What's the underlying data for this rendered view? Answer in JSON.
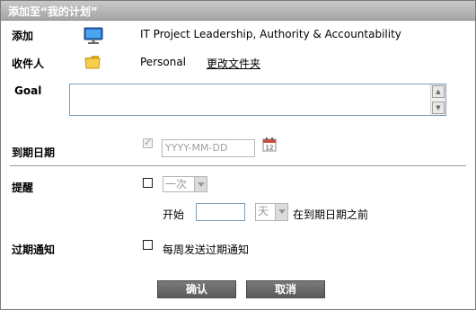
{
  "window": {
    "title": "添加至“我的计划”"
  },
  "add": {
    "label": "添加",
    "icon": "computer-icon",
    "item": "IT Project Leadership, Authority & Accountability"
  },
  "recipient": {
    "label": "收件人",
    "icon": "folder-icon",
    "folder": "Personal",
    "change_link": "更改文件夹"
  },
  "goal": {
    "label": "Goal",
    "value": ""
  },
  "due_date": {
    "label": "到期日期",
    "placeholder": "YYYY-MM-DD",
    "checked": true,
    "icon": "calendar-icon"
  },
  "reminder": {
    "label": "提醒",
    "frequency": "一次",
    "start_label": "开始",
    "start_value": "",
    "unit": "天",
    "suffix": "在到期日期之前"
  },
  "overdue": {
    "label": "过期通知",
    "option": "每周发送过期通知"
  },
  "buttons": {
    "confirm": "确认",
    "cancel": "取消"
  }
}
